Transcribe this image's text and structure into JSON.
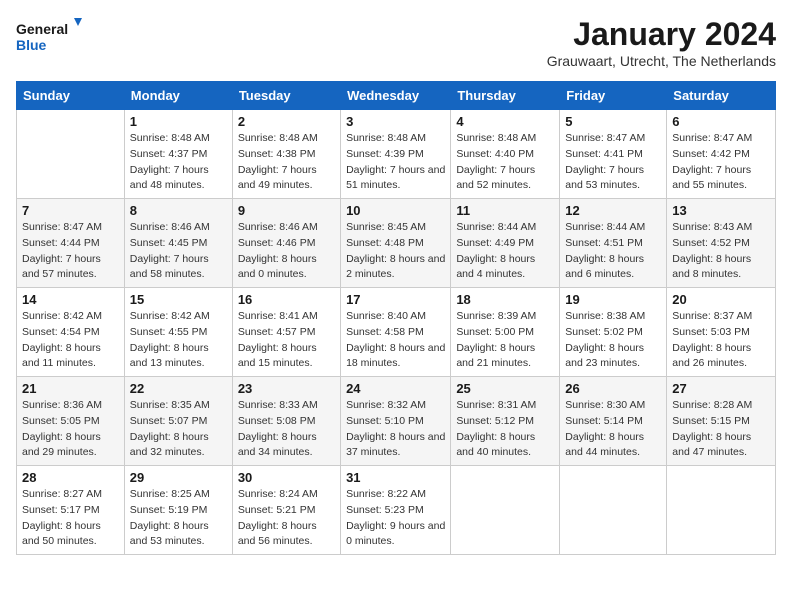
{
  "logo": {
    "line1": "General",
    "line2": "Blue"
  },
  "title": "January 2024",
  "subtitle": "Grauwaart, Utrecht, The Netherlands",
  "days_of_week": [
    "Sunday",
    "Monday",
    "Tuesday",
    "Wednesday",
    "Thursday",
    "Friday",
    "Saturday"
  ],
  "weeks": [
    [
      {
        "day": "",
        "sunrise": "",
        "sunset": "",
        "daylight": ""
      },
      {
        "day": "1",
        "sunrise": "Sunrise: 8:48 AM",
        "sunset": "Sunset: 4:37 PM",
        "daylight": "Daylight: 7 hours and 48 minutes."
      },
      {
        "day": "2",
        "sunrise": "Sunrise: 8:48 AM",
        "sunset": "Sunset: 4:38 PM",
        "daylight": "Daylight: 7 hours and 49 minutes."
      },
      {
        "day": "3",
        "sunrise": "Sunrise: 8:48 AM",
        "sunset": "Sunset: 4:39 PM",
        "daylight": "Daylight: 7 hours and 51 minutes."
      },
      {
        "day": "4",
        "sunrise": "Sunrise: 8:48 AM",
        "sunset": "Sunset: 4:40 PM",
        "daylight": "Daylight: 7 hours and 52 minutes."
      },
      {
        "day": "5",
        "sunrise": "Sunrise: 8:47 AM",
        "sunset": "Sunset: 4:41 PM",
        "daylight": "Daylight: 7 hours and 53 minutes."
      },
      {
        "day": "6",
        "sunrise": "Sunrise: 8:47 AM",
        "sunset": "Sunset: 4:42 PM",
        "daylight": "Daylight: 7 hours and 55 minutes."
      }
    ],
    [
      {
        "day": "7",
        "sunrise": "Sunrise: 8:47 AM",
        "sunset": "Sunset: 4:44 PM",
        "daylight": "Daylight: 7 hours and 57 minutes."
      },
      {
        "day": "8",
        "sunrise": "Sunrise: 8:46 AM",
        "sunset": "Sunset: 4:45 PM",
        "daylight": "Daylight: 7 hours and 58 minutes."
      },
      {
        "day": "9",
        "sunrise": "Sunrise: 8:46 AM",
        "sunset": "Sunset: 4:46 PM",
        "daylight": "Daylight: 8 hours and 0 minutes."
      },
      {
        "day": "10",
        "sunrise": "Sunrise: 8:45 AM",
        "sunset": "Sunset: 4:48 PM",
        "daylight": "Daylight: 8 hours and 2 minutes."
      },
      {
        "day": "11",
        "sunrise": "Sunrise: 8:44 AM",
        "sunset": "Sunset: 4:49 PM",
        "daylight": "Daylight: 8 hours and 4 minutes."
      },
      {
        "day": "12",
        "sunrise": "Sunrise: 8:44 AM",
        "sunset": "Sunset: 4:51 PM",
        "daylight": "Daylight: 8 hours and 6 minutes."
      },
      {
        "day": "13",
        "sunrise": "Sunrise: 8:43 AM",
        "sunset": "Sunset: 4:52 PM",
        "daylight": "Daylight: 8 hours and 8 minutes."
      }
    ],
    [
      {
        "day": "14",
        "sunrise": "Sunrise: 8:42 AM",
        "sunset": "Sunset: 4:54 PM",
        "daylight": "Daylight: 8 hours and 11 minutes."
      },
      {
        "day": "15",
        "sunrise": "Sunrise: 8:42 AM",
        "sunset": "Sunset: 4:55 PM",
        "daylight": "Daylight: 8 hours and 13 minutes."
      },
      {
        "day": "16",
        "sunrise": "Sunrise: 8:41 AM",
        "sunset": "Sunset: 4:57 PM",
        "daylight": "Daylight: 8 hours and 15 minutes."
      },
      {
        "day": "17",
        "sunrise": "Sunrise: 8:40 AM",
        "sunset": "Sunset: 4:58 PM",
        "daylight": "Daylight: 8 hours and 18 minutes."
      },
      {
        "day": "18",
        "sunrise": "Sunrise: 8:39 AM",
        "sunset": "Sunset: 5:00 PM",
        "daylight": "Daylight: 8 hours and 21 minutes."
      },
      {
        "day": "19",
        "sunrise": "Sunrise: 8:38 AM",
        "sunset": "Sunset: 5:02 PM",
        "daylight": "Daylight: 8 hours and 23 minutes."
      },
      {
        "day": "20",
        "sunrise": "Sunrise: 8:37 AM",
        "sunset": "Sunset: 5:03 PM",
        "daylight": "Daylight: 8 hours and 26 minutes."
      }
    ],
    [
      {
        "day": "21",
        "sunrise": "Sunrise: 8:36 AM",
        "sunset": "Sunset: 5:05 PM",
        "daylight": "Daylight: 8 hours and 29 minutes."
      },
      {
        "day": "22",
        "sunrise": "Sunrise: 8:35 AM",
        "sunset": "Sunset: 5:07 PM",
        "daylight": "Daylight: 8 hours and 32 minutes."
      },
      {
        "day": "23",
        "sunrise": "Sunrise: 8:33 AM",
        "sunset": "Sunset: 5:08 PM",
        "daylight": "Daylight: 8 hours and 34 minutes."
      },
      {
        "day": "24",
        "sunrise": "Sunrise: 8:32 AM",
        "sunset": "Sunset: 5:10 PM",
        "daylight": "Daylight: 8 hours and 37 minutes."
      },
      {
        "day": "25",
        "sunrise": "Sunrise: 8:31 AM",
        "sunset": "Sunset: 5:12 PM",
        "daylight": "Daylight: 8 hours and 40 minutes."
      },
      {
        "day": "26",
        "sunrise": "Sunrise: 8:30 AM",
        "sunset": "Sunset: 5:14 PM",
        "daylight": "Daylight: 8 hours and 44 minutes."
      },
      {
        "day": "27",
        "sunrise": "Sunrise: 8:28 AM",
        "sunset": "Sunset: 5:15 PM",
        "daylight": "Daylight: 8 hours and 47 minutes."
      }
    ],
    [
      {
        "day": "28",
        "sunrise": "Sunrise: 8:27 AM",
        "sunset": "Sunset: 5:17 PM",
        "daylight": "Daylight: 8 hours and 50 minutes."
      },
      {
        "day": "29",
        "sunrise": "Sunrise: 8:25 AM",
        "sunset": "Sunset: 5:19 PM",
        "daylight": "Daylight: 8 hours and 53 minutes."
      },
      {
        "day": "30",
        "sunrise": "Sunrise: 8:24 AM",
        "sunset": "Sunset: 5:21 PM",
        "daylight": "Daylight: 8 hours and 56 minutes."
      },
      {
        "day": "31",
        "sunrise": "Sunrise: 8:22 AM",
        "sunset": "Sunset: 5:23 PM",
        "daylight": "Daylight: 9 hours and 0 minutes."
      },
      {
        "day": "",
        "sunrise": "",
        "sunset": "",
        "daylight": ""
      },
      {
        "day": "",
        "sunrise": "",
        "sunset": "",
        "daylight": ""
      },
      {
        "day": "",
        "sunrise": "",
        "sunset": "",
        "daylight": ""
      }
    ]
  ]
}
